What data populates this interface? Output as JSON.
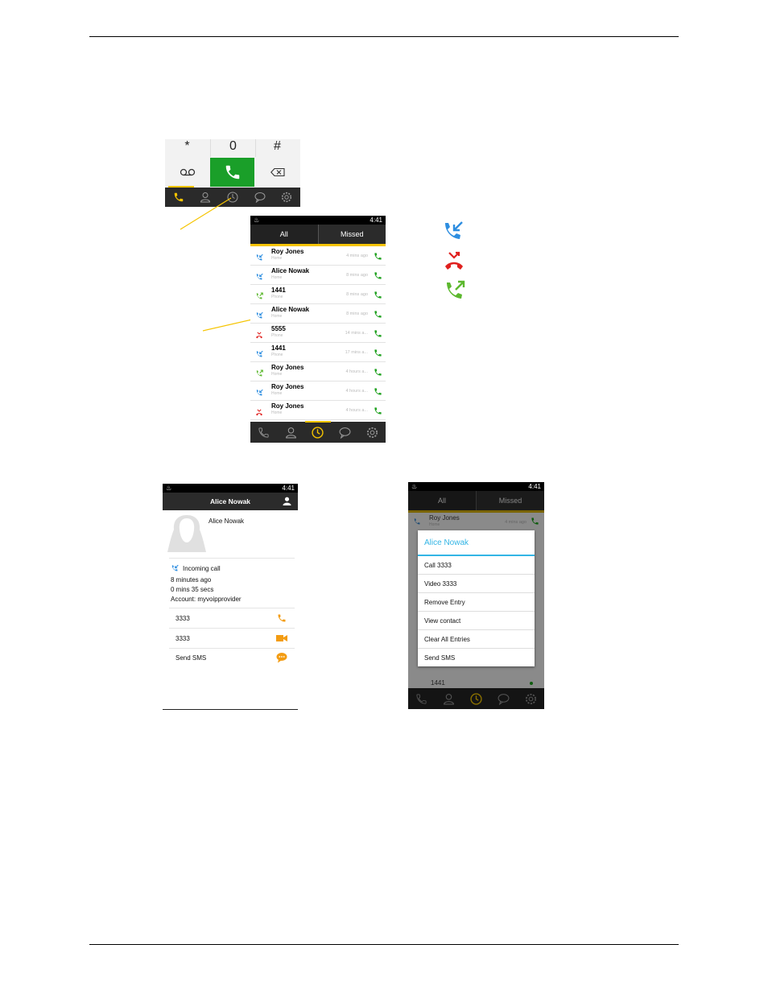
{
  "dialpad": {
    "keys": [
      "*",
      "0",
      "#"
    ],
    "zero_sub": "+"
  },
  "status": {
    "time": "4:41"
  },
  "history": {
    "tabs": [
      "All",
      "Missed"
    ],
    "rows": [
      {
        "name": "Roy Jones",
        "sub": "Home",
        "time": "4 mins ago",
        "type": "incoming"
      },
      {
        "name": "Alice Nowak",
        "sub": "Home",
        "time": "8 mins ago",
        "type": "incoming"
      },
      {
        "name": "1441",
        "sub": "Phone",
        "time": "8 mins ago",
        "type": "outgoing"
      },
      {
        "name": "Alice Nowak",
        "sub": "Home",
        "time": "8 mins ago",
        "type": "incoming"
      },
      {
        "name": "5555",
        "sub": "Phone",
        "time": "14 mins a...",
        "type": "missed"
      },
      {
        "name": "1441",
        "sub": "Phone",
        "time": "17 mins a...",
        "type": "incoming"
      },
      {
        "name": "Roy Jones",
        "sub": "Home",
        "time": "4 hours a...",
        "type": "outgoing"
      },
      {
        "name": "Roy Jones",
        "sub": "Home",
        "time": "4 hours a...",
        "type": "incoming"
      },
      {
        "name": "Roy Jones",
        "sub": "Home",
        "time": "4 hours a...",
        "type": "missed"
      },
      {
        "name": "1441",
        "sub": "",
        "time": "",
        "type": "outgoing"
      }
    ]
  },
  "legend": {
    "incoming_color": "#2e8ee0",
    "missed_color": "#e0201e",
    "outgoing_color": "#5cb82e"
  },
  "detail": {
    "title": "Alice Nowak",
    "contact_name": "Alice Nowak",
    "call_type": "Incoming call",
    "when": "8 minutes ago",
    "duration": "0 mins 35 secs",
    "account": "Account: myvoipprovider",
    "actions": [
      "3333",
      "3333",
      "Send SMS"
    ]
  },
  "menu_screen": {
    "tabs": [
      "All",
      "Missed"
    ],
    "bg_row_name": "Roy Jones",
    "bg_row_sub": "Home",
    "bg_row_time": "4 mins ago",
    "bg_last": "1441",
    "title": "Alice Nowak",
    "items": [
      "Call 3333",
      "Video 3333",
      "Remove Entry",
      "View contact",
      "Clear All Entries",
      "Send SMS"
    ]
  },
  "colors": {
    "accent_yellow": "#f5c400",
    "call_green": "#1fa11f",
    "orange": "#f39c12"
  }
}
